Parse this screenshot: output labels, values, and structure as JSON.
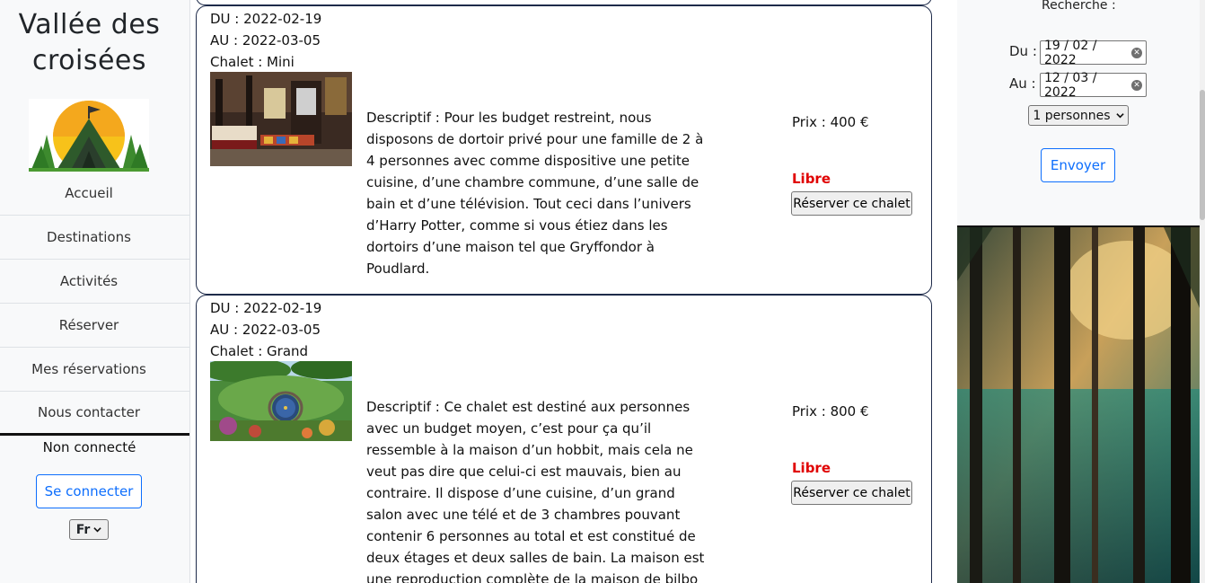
{
  "sidebar": {
    "title": "Vallée des croisées",
    "logo_icon": "camping-tent-logo",
    "nav": [
      {
        "label": "Accueil"
      },
      {
        "label": "Destinations"
      },
      {
        "label": "Activités"
      },
      {
        "label": "Réserver"
      },
      {
        "label": "Mes réservations"
      },
      {
        "label": "Nous contacter"
      }
    ],
    "status": "Non connecté",
    "login_label": "Se connecter",
    "language": "Fr"
  },
  "chalets": [
    {
      "du": "DU : 2022-02-19",
      "au": "AU : 2022-03-05",
      "chalet": "Chalet : Mini",
      "description": "Descriptif : Pour les budget restreint, nous disposons de dortoir privé pour une famille de 2 à 4 personnes avec comme dispositive une petite cuisine, d’une chambre commune, d’une salle de bain et d’une télévision. Tout ceci dans l’univers d’Harry Potter, comme si vous étiez dans les dortoirs d’une maison tel que Gryffondor à Poudlard.",
      "price": "Prix : 400 €",
      "availability": "Libre",
      "book_label": "Réserver ce chalet"
    },
    {
      "du": "DU : 2022-02-19",
      "au": "AU : 2022-03-05",
      "chalet": "Chalet : Grand",
      "description": "Descriptif : Ce chalet est destiné aux personnes avec un budget moyen, c’est pour ça qu’il ressemble à la maison d’un hobbit, mais cela ne veut pas dire que celui-ci est mauvais, bien au contraire. Il dispose d’une cuisine, d’un grand salon avec une télé et de 3 chambres pouvant contenir 6 personnes au total et est constitué de deux étages et deux salles de bain. La maison est une reproduction complète de la maison de bilbo saquet.",
      "price": "Prix : 800 €",
      "availability": "Libre",
      "book_label": "Réserver ce chalet"
    }
  ],
  "search": {
    "title": "Recherche :",
    "du_label": "Du :",
    "du_value": "19 / 02 / 2022",
    "au_label": "Au :",
    "au_value": "12 / 03 / 2022",
    "persons": "1 personnes",
    "submit_label": "Envoyer"
  },
  "colors": {
    "accent": "#0d6efd",
    "available": "#e00000",
    "card_border": "#1e2b4a",
    "sidebar_bg": "#f8f9fa"
  }
}
